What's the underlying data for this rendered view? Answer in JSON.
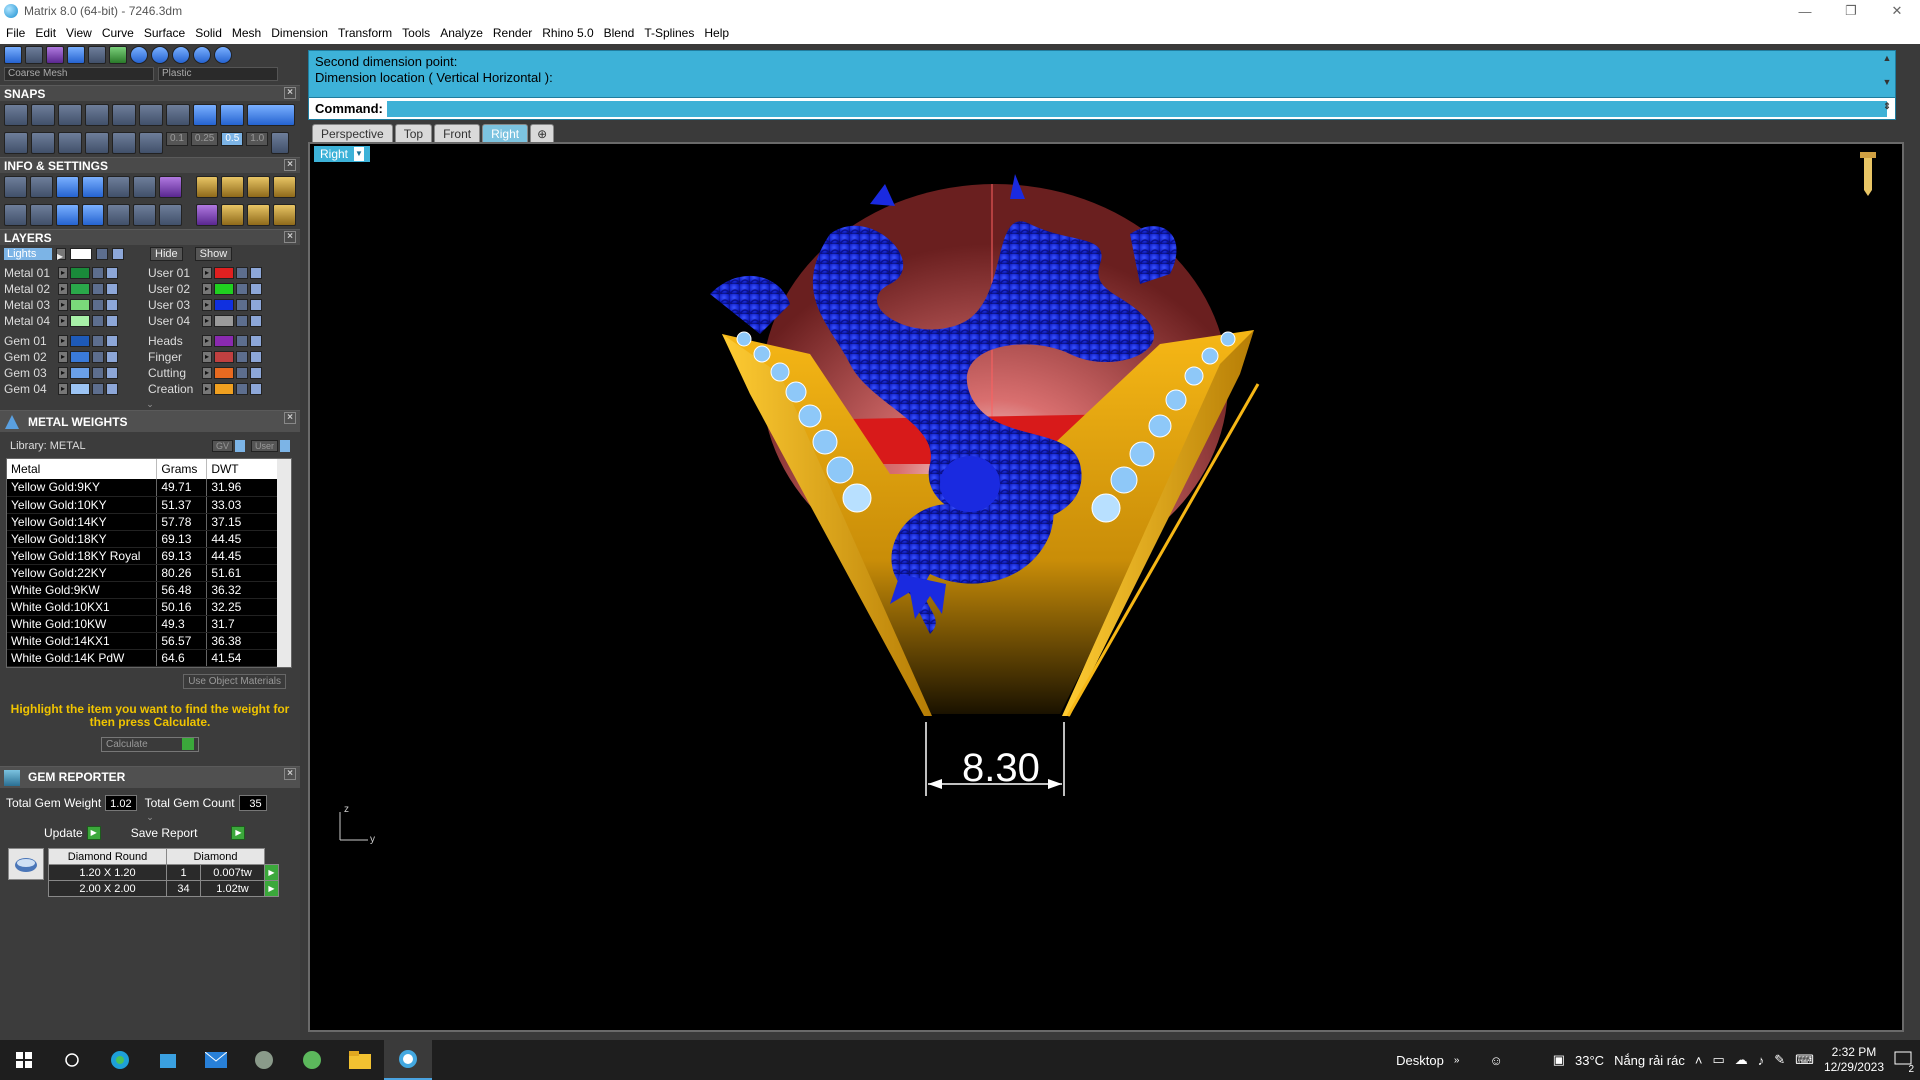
{
  "window": {
    "title": "Matrix 8.0 (64-bit) - 7246.3dm"
  },
  "menu": [
    "File",
    "Edit",
    "View",
    "Curve",
    "Surface",
    "Solid",
    "Mesh",
    "Dimension",
    "Transform",
    "Tools",
    "Analyze",
    "Render",
    "Rhino 5.0",
    "Blend",
    "T-Splines",
    "Help"
  ],
  "toolbar": {
    "mesh_select": "Coarse Mesh",
    "material_select": "Plastic"
  },
  "snaps": {
    "title": "SNAPS",
    "steps": [
      "0.1",
      "0.25",
      "0.5",
      "1.0"
    ]
  },
  "info_settings": {
    "title": "INFO & SETTINGS"
  },
  "layers": {
    "title": "LAYERS",
    "lights": "Lights",
    "hide": "Hide",
    "show": "Show",
    "left": [
      {
        "name": "Metal 01",
        "color": "#1a8a3a"
      },
      {
        "name": "Metal 02",
        "color": "#2aa84a"
      },
      {
        "name": "Metal 03",
        "color": "#7ad87a"
      },
      {
        "name": "Metal 04",
        "color": "#a8f0a8"
      },
      {
        "name": "Gem 01",
        "color": "#1e5ab8"
      },
      {
        "name": "Gem 02",
        "color": "#3a7ad8"
      },
      {
        "name": "Gem 03",
        "color": "#6aa0e8"
      },
      {
        "name": "Gem 04",
        "color": "#9cc4f4"
      }
    ],
    "right": [
      {
        "name": "User 01",
        "color": "#e02020"
      },
      {
        "name": "User 02",
        "color": "#20d020"
      },
      {
        "name": "User 03",
        "color": "#1030e0"
      },
      {
        "name": "User 04",
        "color": "#9a9a9a"
      },
      {
        "name": "Heads",
        "color": "#8a2ab0"
      },
      {
        "name": "Finger",
        "color": "#c04040"
      },
      {
        "name": "Cutting",
        "color": "#e86a20"
      },
      {
        "name": "Creation",
        "color": "#f0a020"
      }
    ]
  },
  "metal_weights": {
    "title": "METAL WEIGHTS",
    "library": "Library: METAL",
    "gv": "GV",
    "user": "User",
    "columns": [
      "Metal",
      "Grams",
      "DWT"
    ],
    "rows": [
      [
        "Yellow Gold:9KY",
        "49.71",
        "31.96"
      ],
      [
        "Yellow Gold:10KY",
        "51.37",
        "33.03"
      ],
      [
        "Yellow Gold:14KY",
        "57.78",
        "37.15"
      ],
      [
        "Yellow Gold:18KY",
        "69.13",
        "44.45"
      ],
      [
        "Yellow Gold:18KY Royal",
        "69.13",
        "44.45"
      ],
      [
        "Yellow Gold:22KY",
        "80.26",
        "51.61"
      ],
      [
        "White Gold:9KW",
        "56.48",
        "36.32"
      ],
      [
        "White Gold:10KX1",
        "50.16",
        "32.25"
      ],
      [
        "White Gold:10KW",
        "49.3",
        "31.7"
      ],
      [
        "White Gold:14KX1",
        "56.57",
        "36.38"
      ],
      [
        "White Gold:14K PdW",
        "64.6",
        "41.54"
      ]
    ],
    "use_object_materials": "Use Object Materials",
    "hint": "Highlight the item you want to find the weight for then press Calculate.",
    "calculate": "Calculate"
  },
  "gem_reporter": {
    "title": "GEM REPORTER",
    "total_weight_label": "Total Gem Weight",
    "total_weight": "1.02",
    "total_count_label": "Total Gem Count",
    "total_count": "35",
    "update": "Update",
    "save_report": "Save Report",
    "headers": [
      "Diamond Round",
      "Diamond"
    ],
    "rows": [
      [
        "1.20 X 1.20",
        "1",
        "0.007tw"
      ],
      [
        "2.00 X 2.00",
        "34",
        "1.02tw"
      ]
    ]
  },
  "command": {
    "history_1": "Second dimension point:",
    "history_2": "Dimension location ( Vertical  Horizontal ):",
    "label": "Command:"
  },
  "viewport_tabs": [
    "Perspective",
    "Top",
    "Front",
    "Right"
  ],
  "viewport": {
    "label": "Right",
    "dimension": "8.30",
    "axis_z": "z",
    "axis_y": "y"
  },
  "taskbar": {
    "desktop": "Desktop",
    "temperature": "33°C",
    "weather": "Nắng rải rác",
    "time": "2:32 PM",
    "date": "12/29/2023",
    "notifications": "2"
  }
}
